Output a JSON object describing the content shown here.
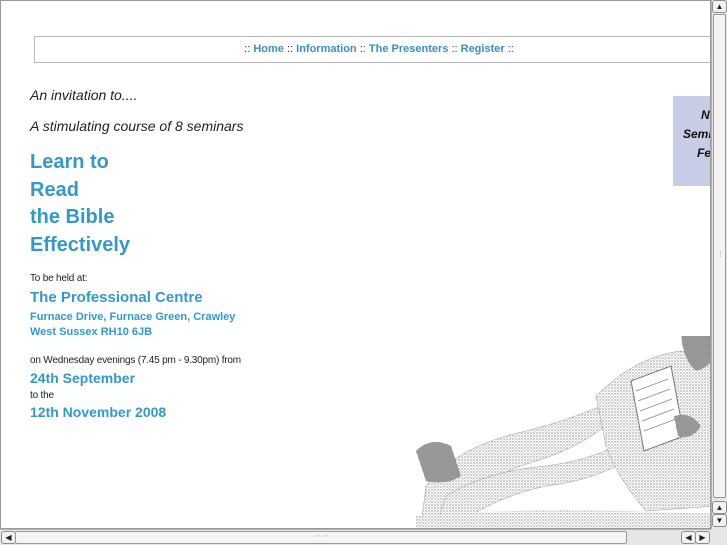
{
  "nav": {
    "prefix": "::",
    "sep": "::",
    "suffix": "::",
    "links": [
      "Home",
      "Information",
      "The Presenters",
      "Register"
    ]
  },
  "content": {
    "intro": "An invitation to....",
    "course": "A stimulating course of 8 seminars",
    "headline": [
      "Learn to",
      "Read",
      "the Bible",
      "Effectively"
    ],
    "held_label": "To be held at:",
    "venue": "The Professional Centre",
    "address_line1": "Furnace Drive, Furnace Green, Crawley",
    "address_line2": "West Sussex RH10 6JB",
    "when": "on Wednesday evenings (7.45 pm - 9.30pm) from",
    "start_date": "24th September",
    "to_label": "to the",
    "end_date": "12th November 2008"
  },
  "side_panel": {
    "line1": "N",
    "line2": "Semi",
    "line3": "Fe"
  },
  "scrollbar": {
    "up_icon": "▲",
    "down_icon": "▼",
    "left_icon": "◀",
    "right_icon": "▶"
  },
  "colors": {
    "accent": "#3399cc",
    "nav_link": "#3a8fc6",
    "side_panel_bg": "#c9cce6"
  }
}
